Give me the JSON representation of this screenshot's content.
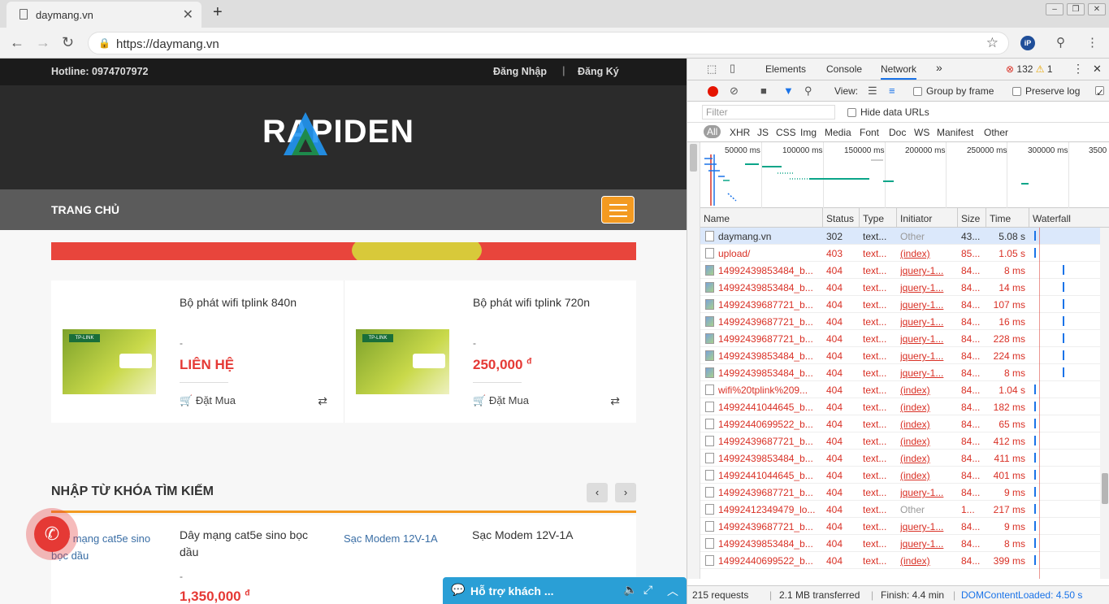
{
  "browser": {
    "tab_title": "daymang.vn",
    "url": "https://daymang.vn",
    "new_tab": "+",
    "close": "✕",
    "ext_badge": "iP"
  },
  "site": {
    "hotline": "Hotline: 0974707972",
    "login": "Đăng Nhập",
    "divider": "|",
    "register": "Đăng Ký",
    "logo_text": "RAPIDEN",
    "nav_home": "TRANG CHỦ",
    "products": [
      {
        "name": "Bộ phát wifi tplink 840n",
        "dash": "-",
        "price": "LIÊN HỆ",
        "buy": "Đặt Mua"
      },
      {
        "name": "Bộ phát wifi tplink 720n",
        "dash": "-",
        "price": "250,000",
        "currency": "đ",
        "buy": "Đặt Mua"
      }
    ],
    "section_title": "NHẬP TỪ KHÓA TÌM KIẾM",
    "products2": [
      {
        "alt": "Dây mạng cat5e sino bọc dầu",
        "name": "Dây mạng cat5e sino bọc dầu",
        "dash": "-",
        "price": "1,350,000",
        "currency": "đ"
      },
      {
        "alt": "Sạc Modem 12V-1A",
        "name": "Sạc Modem 12V-1A"
      }
    ],
    "support_label": "Hỗ trợ khách ..."
  },
  "devtools": {
    "tabs": [
      "Elements",
      "Console",
      "Network"
    ],
    "more": "»",
    "errors": "132",
    "warnings": "1",
    "view_label": "View:",
    "group_by_frame": "Group by frame",
    "preserve_log": "Preserve log",
    "filter_placeholder": "Filter",
    "hide_data_urls": "Hide data URLs",
    "types": [
      "All",
      "XHR",
      "JS",
      "CSS",
      "Img",
      "Media",
      "Font",
      "Doc",
      "WS",
      "Manifest",
      "Other"
    ],
    "overview_ticks": [
      "50000 ms",
      "100000 ms",
      "150000 ms",
      "200000 ms",
      "250000 ms",
      "300000 ms",
      "3500"
    ],
    "columns": [
      "Name",
      "Status",
      "Type",
      "Initiator",
      "Size",
      "Time",
      "Waterfall"
    ],
    "rows": [
      {
        "name": "daymang.vn",
        "status": "302",
        "type": "text...",
        "initiator": "Other",
        "size": "43...",
        "time": "5.08 s",
        "icon": "doc",
        "err": false,
        "sel": true,
        "wf": 0.0
      },
      {
        "name": "upload/",
        "status": "403",
        "type": "text...",
        "initiator": "(index)",
        "size": "85...",
        "time": "1.05 s",
        "icon": "doc",
        "err": true,
        "wf": 0.0
      },
      {
        "name": "14992439853484_b...",
        "status": "404",
        "type": "text...",
        "initiator": "jquery-1...",
        "size": "84...",
        "time": "8 ms",
        "icon": "img",
        "err": true,
        "wf": 0.5
      },
      {
        "name": "14992439853484_b...",
        "status": "404",
        "type": "text...",
        "initiator": "jquery-1...",
        "size": "84...",
        "time": "14 ms",
        "icon": "img",
        "err": true,
        "wf": 0.5
      },
      {
        "name": "14992439687721_b...",
        "status": "404",
        "type": "text...",
        "initiator": "jquery-1...",
        "size": "84...",
        "time": "107 ms",
        "icon": "img",
        "err": true,
        "wf": 0.5
      },
      {
        "name": "14992439687721_b...",
        "status": "404",
        "type": "text...",
        "initiator": "jquery-1...",
        "size": "84...",
        "time": "16 ms",
        "icon": "img",
        "err": true,
        "wf": 0.5
      },
      {
        "name": "14992439687721_b...",
        "status": "404",
        "type": "text...",
        "initiator": "jquery-1...",
        "size": "84...",
        "time": "228 ms",
        "icon": "img",
        "err": true,
        "wf": 0.5
      },
      {
        "name": "14992439853484_b...",
        "status": "404",
        "type": "text...",
        "initiator": "jquery-1...",
        "size": "84...",
        "time": "224 ms",
        "icon": "img",
        "err": true,
        "wf": 0.5
      },
      {
        "name": "14992439853484_b...",
        "status": "404",
        "type": "text...",
        "initiator": "jquery-1...",
        "size": "84...",
        "time": "8 ms",
        "icon": "img",
        "err": true,
        "wf": 0.5
      },
      {
        "name": "wifi%20tplink%209...",
        "status": "404",
        "type": "text...",
        "initiator": "(index)",
        "size": "84...",
        "time": "1.04 s",
        "icon": "doc",
        "err": true,
        "wf": 0.0
      },
      {
        "name": "14992441044645_b...",
        "status": "404",
        "type": "text...",
        "initiator": "(index)",
        "size": "84...",
        "time": "182 ms",
        "icon": "doc",
        "err": true,
        "wf": 0.0
      },
      {
        "name": "14992440699522_b...",
        "status": "404",
        "type": "text...",
        "initiator": "(index)",
        "size": "84...",
        "time": "65 ms",
        "icon": "doc",
        "err": true,
        "wf": 0.0
      },
      {
        "name": "14992439687721_b...",
        "status": "404",
        "type": "text...",
        "initiator": "(index)",
        "size": "84...",
        "time": "412 ms",
        "icon": "doc",
        "err": true,
        "wf": 0.0
      },
      {
        "name": "14992439853484_b...",
        "status": "404",
        "type": "text...",
        "initiator": "(index)",
        "size": "84...",
        "time": "411 ms",
        "icon": "doc",
        "err": true,
        "wf": 0.0
      },
      {
        "name": "14992441044645_b...",
        "status": "404",
        "type": "text...",
        "initiator": "(index)",
        "size": "84...",
        "time": "401 ms",
        "icon": "doc",
        "err": true,
        "wf": 0.0
      },
      {
        "name": "14992439687721_b...",
        "status": "404",
        "type": "text...",
        "initiator": "jquery-1...",
        "size": "84...",
        "time": "9 ms",
        "icon": "doc",
        "err": true,
        "wf": 0.0
      },
      {
        "name": "14992412349479_lo...",
        "status": "404",
        "type": "text...",
        "initiator": "Other",
        "size": "1...",
        "time": "217 ms",
        "icon": "doc",
        "err": true,
        "wf": 0.0
      },
      {
        "name": "14992439687721_b...",
        "status": "404",
        "type": "text...",
        "initiator": "jquery-1...",
        "size": "84...",
        "time": "9 ms",
        "icon": "doc",
        "err": true,
        "wf": 0.0
      },
      {
        "name": "14992439853484_b...",
        "status": "404",
        "type": "text...",
        "initiator": "jquery-1...",
        "size": "84...",
        "time": "8 ms",
        "icon": "doc",
        "err": true,
        "wf": 0.0
      },
      {
        "name": "14992440699522_b...",
        "status": "404",
        "type": "text...",
        "initiator": "(index)",
        "size": "84...",
        "time": "399 ms",
        "icon": "doc",
        "err": true,
        "wf": 0.0
      }
    ],
    "status": {
      "requests": "215 requests",
      "transferred": "2.1 MB transferred",
      "finish": "Finish: 4.4 min",
      "dom": "DOMContentLoaded: 4.50 s"
    }
  },
  "colors": {
    "accent_orange": "#f39a21",
    "price_red": "#e53935",
    "devtools_blue": "#1a73e8",
    "error_red": "#d93025"
  }
}
